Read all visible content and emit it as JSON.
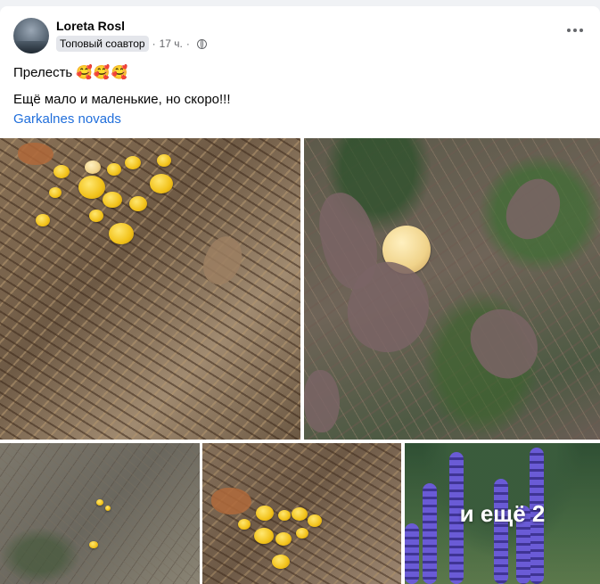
{
  "post": {
    "author": "Loreta Rosl",
    "badge": "Топовый соавтор",
    "separator": "·",
    "time": "17 ч.",
    "visibility_icon": "globe-icon",
    "text_line1": "Прелесть",
    "emoji": "🥰🥰🥰",
    "text_line2": "Ещё мало и маленькие, но скоро!!!",
    "location": "Garkalnes novads",
    "more_photos_label": "и ещё 2"
  },
  "colors": {
    "link": "#216fdb",
    "text": "#050505",
    "muted": "#65676b",
    "badge_bg": "#e4e6eb"
  }
}
